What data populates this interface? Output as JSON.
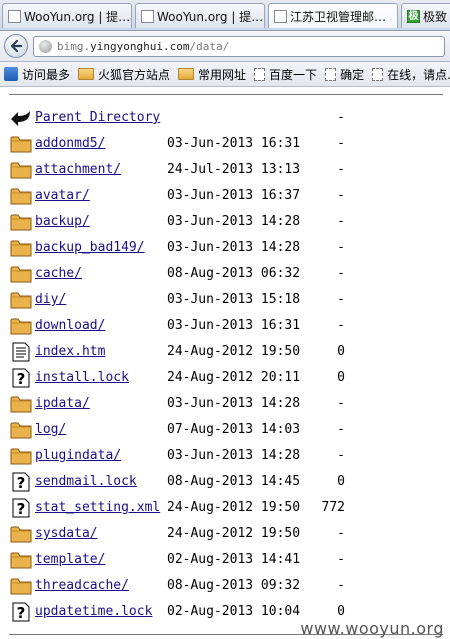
{
  "tabs": [
    {
      "label": "WooYun.org | 提…",
      "icon": "page-icon",
      "active": false
    },
    {
      "label": "WooYun.org | 提…",
      "icon": "page-icon",
      "active": false
    },
    {
      "label": "江苏卫视管理邮…",
      "icon": "page-icon",
      "active": true
    },
    {
      "label": "极致",
      "icon": "green-app-icon",
      "icon_char": "极",
      "active": false
    }
  ],
  "address": {
    "host_dim": "bimg.",
    "host": "yingyonghui.com",
    "path": "/data/"
  },
  "bookmarks": [
    {
      "label": "访问最多",
      "icon": "bookmark-icon"
    },
    {
      "label": "火狐官方站点",
      "icon": "folder-icon"
    },
    {
      "label": "常用网址",
      "icon": "folder-icon"
    },
    {
      "label": "百度一下",
      "icon": "page-icon"
    },
    {
      "label": "确定",
      "icon": "page-icon"
    },
    {
      "label": "在线，请点…",
      "icon": "page-icon"
    }
  ],
  "listing": {
    "parent_label": "Parent Directory",
    "parent_size": "-",
    "entries": [
      {
        "name": "addonmd5/",
        "type": "folder",
        "date": "03-Jun-2013 16:31",
        "size": "-"
      },
      {
        "name": "attachment/",
        "type": "folder",
        "date": "24-Jul-2013 13:13",
        "size": "-"
      },
      {
        "name": "avatar/",
        "type": "folder",
        "date": "03-Jun-2013 16:37",
        "size": "-"
      },
      {
        "name": "backup/",
        "type": "folder",
        "date": "03-Jun-2013 14:28",
        "size": "-"
      },
      {
        "name": "backup_bad149/",
        "type": "folder",
        "date": "03-Jun-2013 14:28",
        "size": "-"
      },
      {
        "name": "cache/",
        "type": "folder",
        "date": "08-Aug-2013 06:32",
        "size": "-"
      },
      {
        "name": "diy/",
        "type": "folder",
        "date": "03-Jun-2013 15:18",
        "size": "-"
      },
      {
        "name": "download/",
        "type": "folder",
        "date": "03-Jun-2013 16:31",
        "size": "-"
      },
      {
        "name": "index.htm",
        "type": "text",
        "date": "24-Aug-2012 19:50",
        "size": "0"
      },
      {
        "name": "install.lock",
        "type": "unknown",
        "date": "24-Aug-2012 20:11",
        "size": "0"
      },
      {
        "name": "ipdata/",
        "type": "folder",
        "date": "03-Jun-2013 14:28",
        "size": "-"
      },
      {
        "name": "log/",
        "type": "folder",
        "date": "07-Aug-2013 14:03",
        "size": "-"
      },
      {
        "name": "plugindata/",
        "type": "folder",
        "date": "03-Jun-2013 14:28",
        "size": "-"
      },
      {
        "name": "sendmail.lock",
        "type": "unknown",
        "date": "08-Aug-2013 14:45",
        "size": "0"
      },
      {
        "name": "stat_setting.xml",
        "type": "unknown",
        "date": "24-Aug-2012 19:50",
        "size": "772"
      },
      {
        "name": "sysdata/",
        "type": "folder",
        "date": "24-Aug-2012 19:50",
        "size": "-"
      },
      {
        "name": "template/",
        "type": "folder",
        "date": "02-Aug-2013 14:41",
        "size": "-"
      },
      {
        "name": "threadcache/",
        "type": "folder",
        "date": "08-Aug-2013 09:32",
        "size": "-"
      },
      {
        "name": "updatetime.lock",
        "type": "unknown",
        "date": "02-Aug-2013 10:04",
        "size": "0"
      }
    ]
  },
  "watermark": "www.wooyun.org",
  "colors": {
    "link": "#1a0f8a",
    "folder": "#e9b24a",
    "rule": "#777777"
  }
}
